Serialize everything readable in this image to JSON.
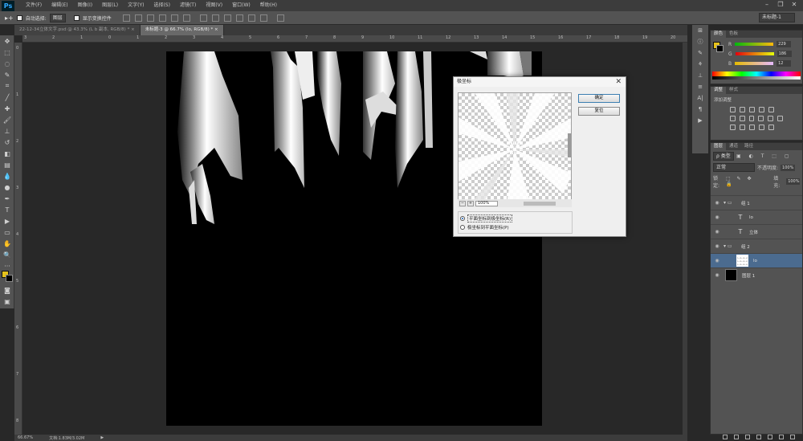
{
  "app": {
    "logo": "Ps"
  },
  "menu": [
    "文件(F)",
    "编辑(E)",
    "图像(I)",
    "图层(L)",
    "文字(Y)",
    "选择(S)",
    "滤镜(T)",
    "视图(V)",
    "窗口(W)",
    "帮助(H)"
  ],
  "window_controls": [
    "–",
    "❐",
    "✕"
  ],
  "options_bar": {
    "auto_select_label": "自动选择:",
    "auto_select_value": "图层",
    "show_transform_label": "显示变换控件",
    "workspace": "未标题-1"
  },
  "tabs": [
    {
      "label": "22-12-34立体文字.psd @ 43.3% (L b 副本, RGB/8) *",
      "close": "×",
      "active": false
    },
    {
      "label": "未标题-3 @ 66.7% (lo, RGB/8) *",
      "close": "×",
      "active": true
    }
  ],
  "ruler_top_numbers": [
    "3",
    "2",
    "1",
    "0",
    "1",
    "2",
    "3",
    "4",
    "5",
    "6",
    "7",
    "8",
    "9",
    "10",
    "11",
    "12",
    "13",
    "14",
    "15",
    "16",
    "17",
    "18",
    "19",
    "20"
  ],
  "ruler_left_numbers": [
    "0",
    "1",
    "2",
    "3",
    "4",
    "5",
    "6",
    "7",
    "8"
  ],
  "status": {
    "zoom": "66.67%",
    "info": "文档:1.83M/3.02M"
  },
  "color_panel": {
    "tabs": [
      "颜色",
      "色板"
    ],
    "channels": [
      {
        "label": "R",
        "value": "229"
      },
      {
        "label": "G",
        "value": "186"
      },
      {
        "label": "B",
        "value": "12"
      }
    ],
    "fg_color": "#e6c21a",
    "bg_color": "#000000"
  },
  "adjust_panel": {
    "tabs": [
      "调整",
      "样式"
    ],
    "title": "添加调整"
  },
  "layers_panel": {
    "tabs": [
      "图层",
      "通道",
      "路径"
    ],
    "filter_label": "ρ 类型",
    "blend_mode": "正常",
    "opacity_label": "不透明度:",
    "opacity_value": "100%",
    "lock_label": "锁定:",
    "fill_label": "填充:",
    "fill_value": "100%",
    "layers": [
      {
        "name": "组 1",
        "type": "group",
        "selected": false
      },
      {
        "name": "lo",
        "type": "text",
        "selected": false
      },
      {
        "name": "立体",
        "type": "text",
        "selected": false
      },
      {
        "name": "组 2",
        "type": "group",
        "selected": false
      },
      {
        "name": "lo",
        "type": "pixel",
        "selected": true
      },
      {
        "name": "图层 1",
        "type": "black",
        "selected": false
      }
    ]
  },
  "dialog": {
    "title": "极坐标",
    "close": "✕",
    "ok_label": "确定",
    "reset_label": "复位",
    "zoom_value": "100%",
    "zoom_out": "−",
    "zoom_in": "+",
    "options": [
      {
        "label": "平面坐标到极坐标(R)",
        "selected": true
      },
      {
        "label": "极坐标到平面坐标(P)",
        "selected": false
      }
    ]
  }
}
